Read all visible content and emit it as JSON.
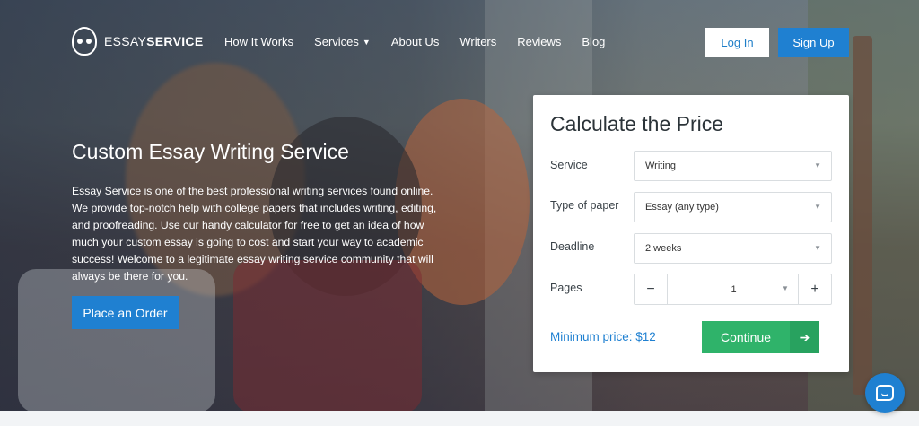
{
  "header": {
    "logo_prefix": "ESSAY",
    "logo_suffix": "SERVICE",
    "nav": [
      {
        "label": "How It Works"
      },
      {
        "label": "Services"
      },
      {
        "label": "About Us"
      },
      {
        "label": "Writers"
      },
      {
        "label": "Reviews"
      },
      {
        "label": "Blog"
      }
    ],
    "login_label": "Log In",
    "signup_label": "Sign Up"
  },
  "hero": {
    "title": "Custom Essay Writing Service",
    "description": "Essay Service is one of the best professional writing services found online. We provide top-notch help with college papers that includes writing, editing, and proofreading. Use our handy calculator for free to get an idea of how much your custom essay is going to cost and start your way to academic success! Welcome to a legitimate essay writing service community that will always be there for you.",
    "order_button": "Place an Order"
  },
  "calculator": {
    "title": "Calculate the Price",
    "service_label": "Service",
    "service_value": "Writing",
    "paper_label": "Type of paper",
    "paper_value": "Essay (any type)",
    "deadline_label": "Deadline",
    "deadline_value": "2 weeks",
    "pages_label": "Pages",
    "pages_value": "1",
    "minus": "−",
    "plus": "+",
    "min_price": "Minimum price: $12",
    "continue_label": "Continue"
  },
  "icons": {
    "dropdown": "▼",
    "arrow_right": "➔"
  },
  "colors": {
    "primary": "#1f80d1",
    "success": "#2fb36a"
  }
}
